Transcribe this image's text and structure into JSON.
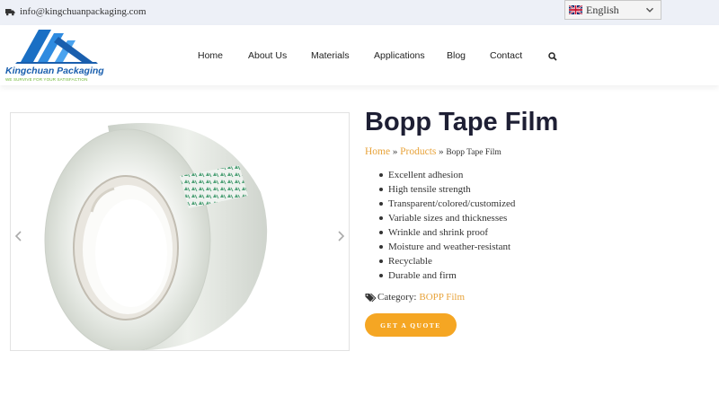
{
  "topbar": {
    "email": "info@kingchuanpackaging.com",
    "language": "English"
  },
  "logo": {
    "brand": "Kingchuan Packaging",
    "tagline": "WE SURVIVE FOR YOUR SATISFACTION"
  },
  "nav": {
    "items": [
      "Home",
      "About Us",
      "Materials",
      "Applications",
      "Blog",
      "Contact"
    ]
  },
  "product": {
    "title": "Bopp Tape Film",
    "breadcrumb": {
      "home": "Home",
      "sep": "»",
      "products": "Products",
      "current": "Bopp Tape Film"
    },
    "features": [
      "Excellent adhesion",
      "High tensile strength",
      "Transparent/colored/customized",
      "Variable sizes and thicknesses",
      "Wrinkle and shrink proof",
      "Moisture and weather-resistant",
      "Recyclable",
      "Durable and firm"
    ],
    "category_label": "Category:",
    "category_value": "BOPP Film",
    "cta": "GET A QUOTE"
  },
  "colors": {
    "accent": "#f5a623",
    "link": "#e8a33a",
    "title": "#1e1f34",
    "topbar": "#edf0f7",
    "logo_blue": "#1a5fae",
    "logo_green": "#6ab42d"
  },
  "icons": [
    "truck-icon",
    "flag-uk-icon",
    "chevron-down-icon",
    "search-icon",
    "tags-icon",
    "arrow-left-icon",
    "arrow-right-icon"
  ]
}
